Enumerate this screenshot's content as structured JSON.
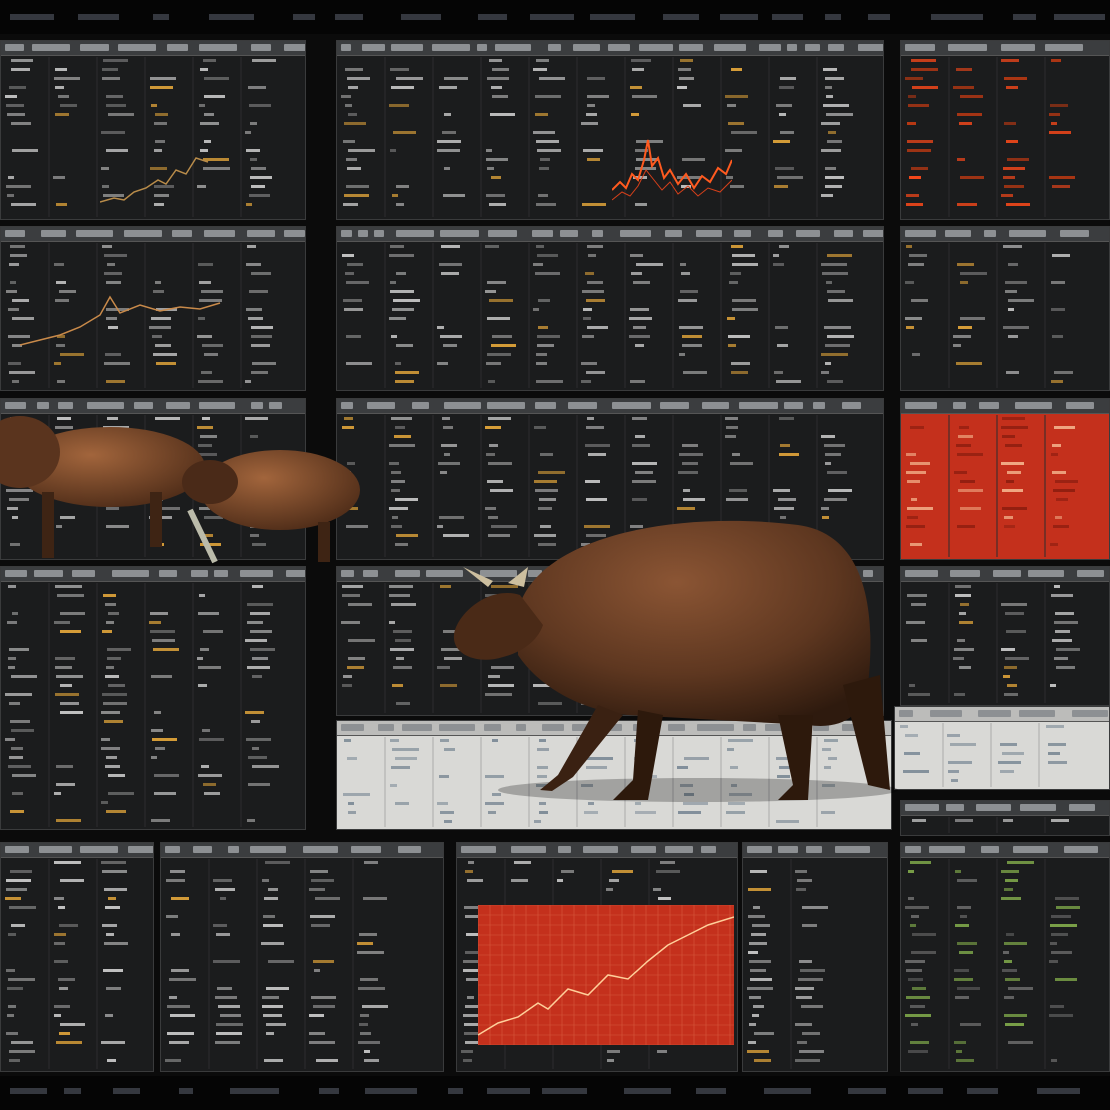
{
  "scene": {
    "subject": "bull-market-trading-screens",
    "colors": {
      "background": "#0b0b0b",
      "panel": "#1b1c1d",
      "panel_border": "#3a3b3c",
      "header": "#3b3d3f",
      "data_text": "#c9c9c9",
      "data_highlight": "#e0a43a",
      "red_panel": "#c4301c",
      "red_chart_line": "#ff6a2a",
      "green_data": "#7fa84a",
      "bull_brown": "#6b3f26",
      "floor": "#d8d8d5"
    },
    "icons": [
      "bull-figure",
      "bull-figure-small",
      "price-chart",
      "data-table"
    ]
  }
}
